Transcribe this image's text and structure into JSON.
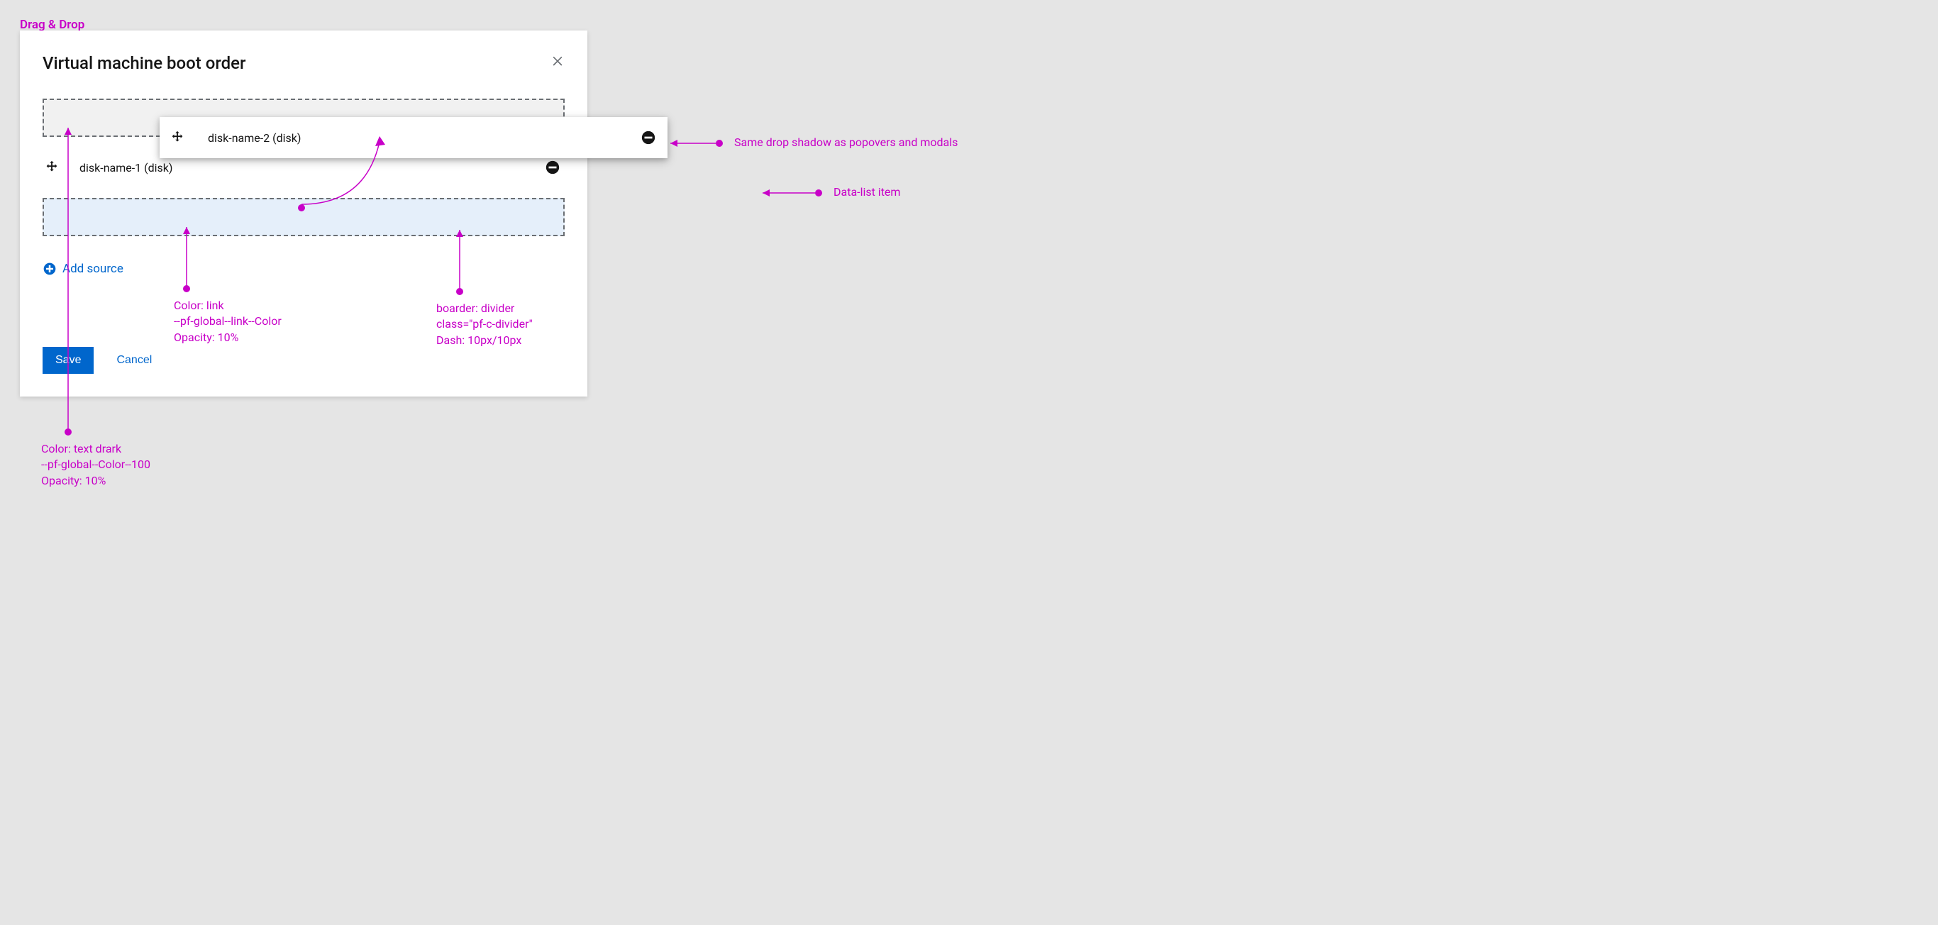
{
  "section_label": "Drag & Drop",
  "modal": {
    "title": "Virtual machine boot order",
    "close_label": "Close"
  },
  "floating_item": {
    "label": "disk-name-2 (disk)"
  },
  "row1": {
    "label": "disk-name-1 (disk)"
  },
  "add_source_label": "Add source",
  "footer": {
    "save": "Save",
    "cancel": "Cancel"
  },
  "annotations": {
    "shadow": "Same drop shadow as popovers and modals",
    "datalist": "Data-list item",
    "link_color_l1": "Color: link",
    "link_color_l2": "--pf-global--link--Color",
    "link_color_l3": "Opacity: 10%",
    "border_l1": "boarder: divider",
    "border_l2": "class=\"pf-c-divider\"",
    "border_l3": "Dash: 10px/10px",
    "textdark_l1": "Color: text drark",
    "textdark_l2": "--pf-global--Color--100",
    "textdark_l3": "Opacity: 10%"
  }
}
